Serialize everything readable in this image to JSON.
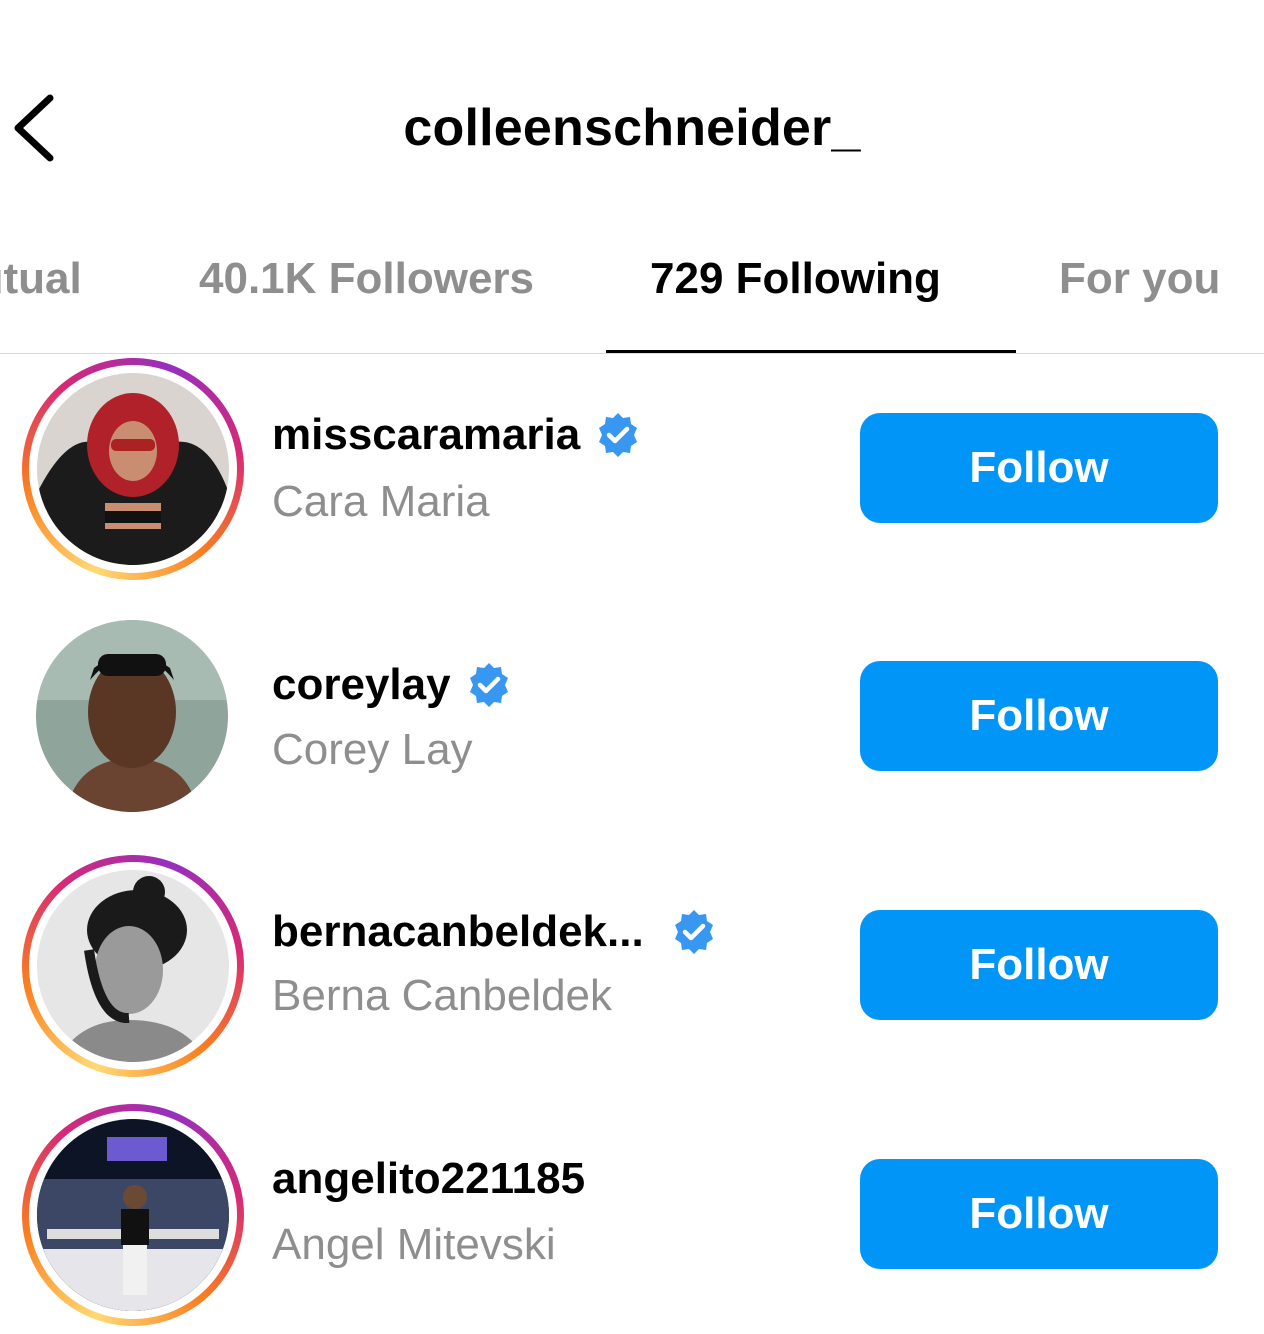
{
  "header": {
    "title": "colleenschneider_"
  },
  "tabs": [
    {
      "label": "Mutual",
      "active": false
    },
    {
      "label": "40.1K Followers",
      "active": false
    },
    {
      "label": "729 Following",
      "active": true
    },
    {
      "label": "For you",
      "active": false
    }
  ],
  "accounts": [
    {
      "username": "misscaramaria",
      "full_name": "Cara Maria",
      "verified": true,
      "story_ring": true,
      "button": "Follow"
    },
    {
      "username": "coreylay",
      "full_name": "Corey Lay",
      "verified": true,
      "story_ring": false,
      "button": "Follow"
    },
    {
      "username": "bernacanbeldek...",
      "full_name": "Berna Canbeldek",
      "verified": true,
      "story_ring": true,
      "button": "Follow"
    },
    {
      "username": "angelito221185",
      "full_name": "Angel Mitevski",
      "verified": false,
      "story_ring": true,
      "button": "Follow"
    }
  ],
  "colors": {
    "follow_button": "#0095f6",
    "verified_badge": "#3897f0",
    "muted_text": "#8e8e8e"
  },
  "icons": {
    "back": "chevron-left-icon",
    "verified": "verified-badge-icon"
  }
}
